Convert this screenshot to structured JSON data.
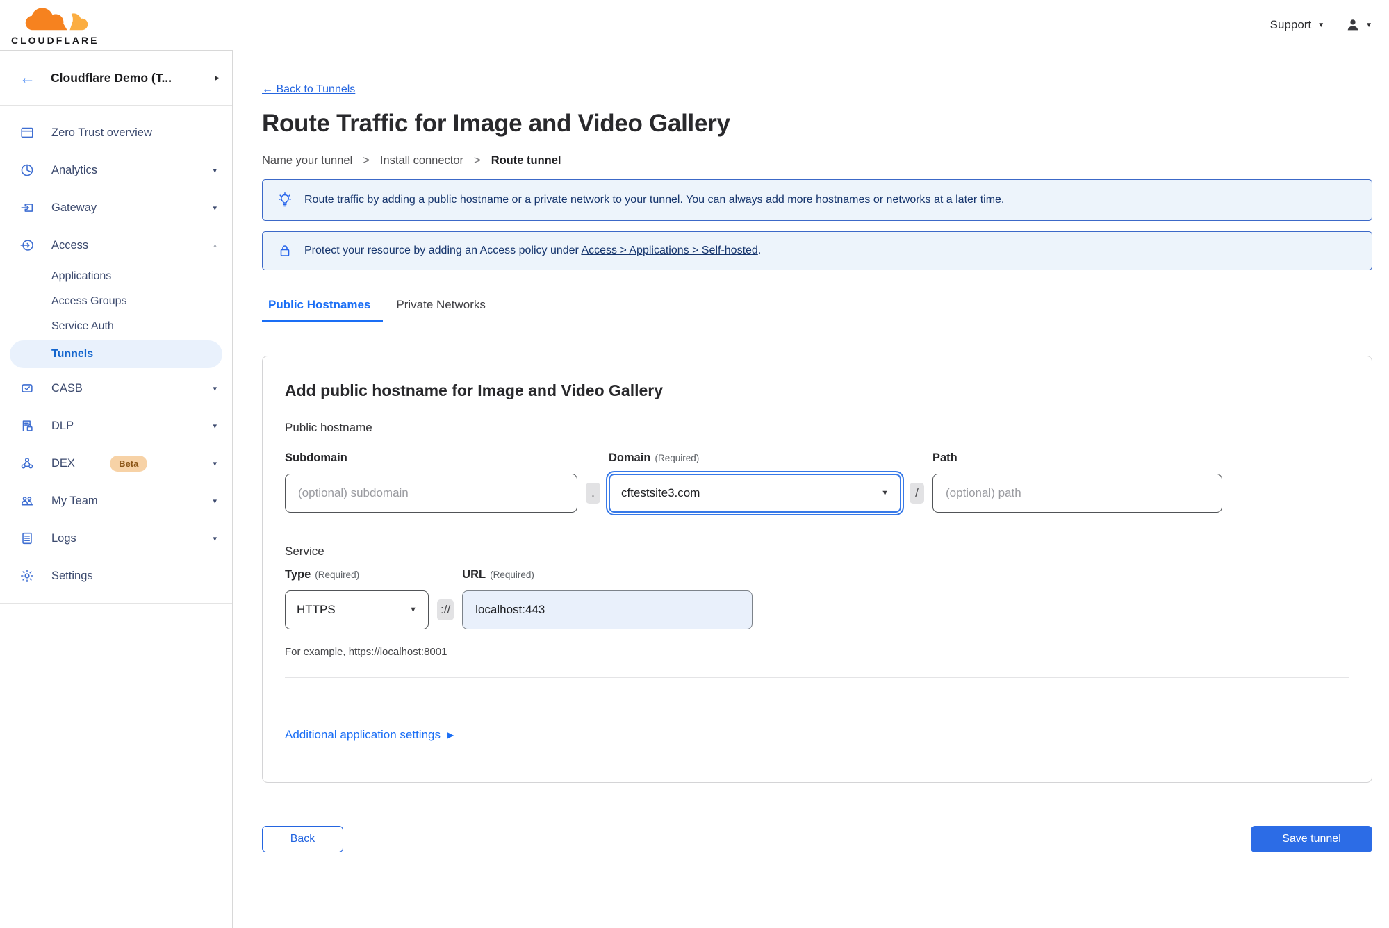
{
  "colors": {
    "accent": "#2c6ce6",
    "link": "#2465e0",
    "tab_active": "#1a6ef5",
    "sidebar_active_bg": "#e9f1fc",
    "banner_bg": "#edf4fb",
    "banner_border": "#3c69c8",
    "banner_text": "#16356d",
    "beta_badge_bg": "#f7d2a6",
    "url_field_bg": "#e9f0fb",
    "logo_orange": "#f6821f",
    "logo_light_orange": "#fbad41"
  },
  "icons": {
    "back_arrow": "←",
    "caret_right": "▸",
    "caret_down": "▾",
    "caret_up": "▴",
    "dropdown": "▼",
    "expand": "▶"
  },
  "header": {
    "logo_text": "CLOUDFLARE",
    "support_label": "Support"
  },
  "sidebar": {
    "account_label": "Cloudflare Demo (T...",
    "items": [
      {
        "label": "Zero Trust overview"
      },
      {
        "label": "Analytics"
      },
      {
        "label": "Gateway"
      },
      {
        "label": "Access"
      },
      {
        "label": "CASB"
      },
      {
        "label": "DLP"
      },
      {
        "label": "DEX",
        "badge": "Beta"
      },
      {
        "label": "My Team"
      },
      {
        "label": "Logs"
      },
      {
        "label": "Settings"
      }
    ],
    "access_subitems": [
      {
        "label": "Applications"
      },
      {
        "label": "Access Groups"
      },
      {
        "label": "Service Auth"
      },
      {
        "label": "Tunnels",
        "active": true
      }
    ]
  },
  "main": {
    "back_link": "← Back to Tunnels",
    "title": "Route Traffic for Image and Video Gallery",
    "steps": {
      "s0": "Name your tunnel",
      "s1": "Install connector",
      "s2": "Route tunnel",
      "separator": ">"
    },
    "banners": {
      "tip": "Route traffic by adding a public hostname or a private network to your tunnel. You can always add more hostnames or networks at a later time.",
      "protect_prefix": "Protect your resource by adding an Access policy under",
      "protect_link": "Access > Applications > Self-hosted",
      "protect_suffix": "."
    },
    "tabs": {
      "t0": "Public Hostnames",
      "t1": "Private Networks"
    },
    "card": {
      "heading": "Add public hostname for Image and Video Gallery",
      "public_hostname_label": "Public hostname",
      "subdomain_label": "Subdomain",
      "subdomain_placeholder": "(optional) subdomain",
      "dot_separator": ".",
      "domain_label": "Domain",
      "domain_required": "(Required)",
      "domain_value": "cftestsite3.com",
      "slash_separator": "/",
      "path_label": "Path",
      "path_placeholder": "(optional) path",
      "service_label": "Service",
      "type_label": "Type",
      "type_required": "(Required)",
      "type_value": "HTTPS",
      "protocol_separator": "://",
      "url_label": "URL",
      "url_required": "(Required)",
      "url_value": "localhost:443",
      "example_hint": "For example, https://localhost:8001",
      "additional_settings_label": "Additional application settings"
    },
    "footer": {
      "back_label": "Back",
      "save_label": "Save tunnel"
    }
  }
}
